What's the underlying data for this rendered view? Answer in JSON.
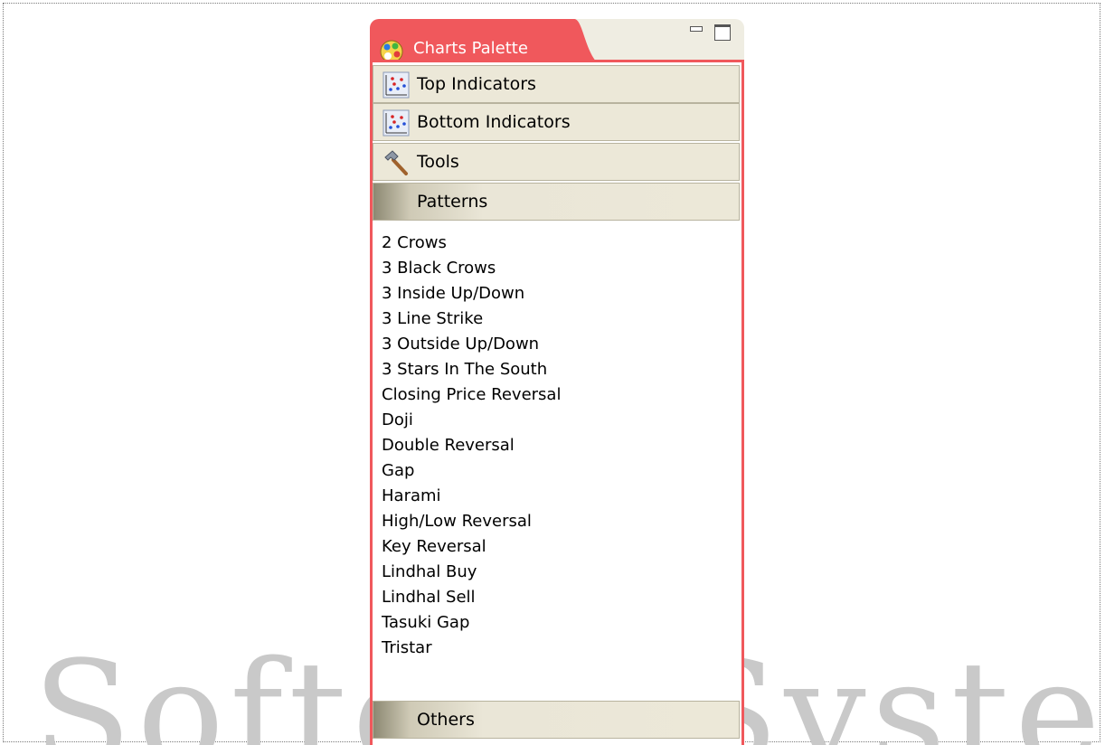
{
  "watermark": {
    "text": "Softech Systems"
  },
  "palette": {
    "title": "Charts Palette",
    "close_glyph": "✕",
    "icon": "palette-icon",
    "minimize_icon": "minimize-icon",
    "maximize_icon": "maximize-icon",
    "accent_color": "#f0585c",
    "drawers": {
      "top_indicators": {
        "label": "Top Indicators",
        "icon": "scatter-chart-icon"
      },
      "bottom_indicators": {
        "label": "Bottom Indicators",
        "icon": "scatter-chart-icon"
      },
      "tools": {
        "label": "Tools",
        "icon": "hammer-icon"
      },
      "patterns": {
        "label": "Patterns",
        "expanded": true
      },
      "others": {
        "label": "Others"
      }
    },
    "patterns": [
      "2 Crows",
      "3 Black Crows",
      "3 Inside Up/Down",
      "3 Line Strike",
      "3 Outside Up/Down",
      "3 Stars In The South",
      "Closing Price Reversal",
      "Doji",
      "Double Reversal",
      "Gap",
      "Harami",
      "High/Low Reversal",
      "Key Reversal",
      "Lindhal Buy",
      "Lindhal Sell",
      "Tasuki Gap",
      "Tristar"
    ]
  }
}
